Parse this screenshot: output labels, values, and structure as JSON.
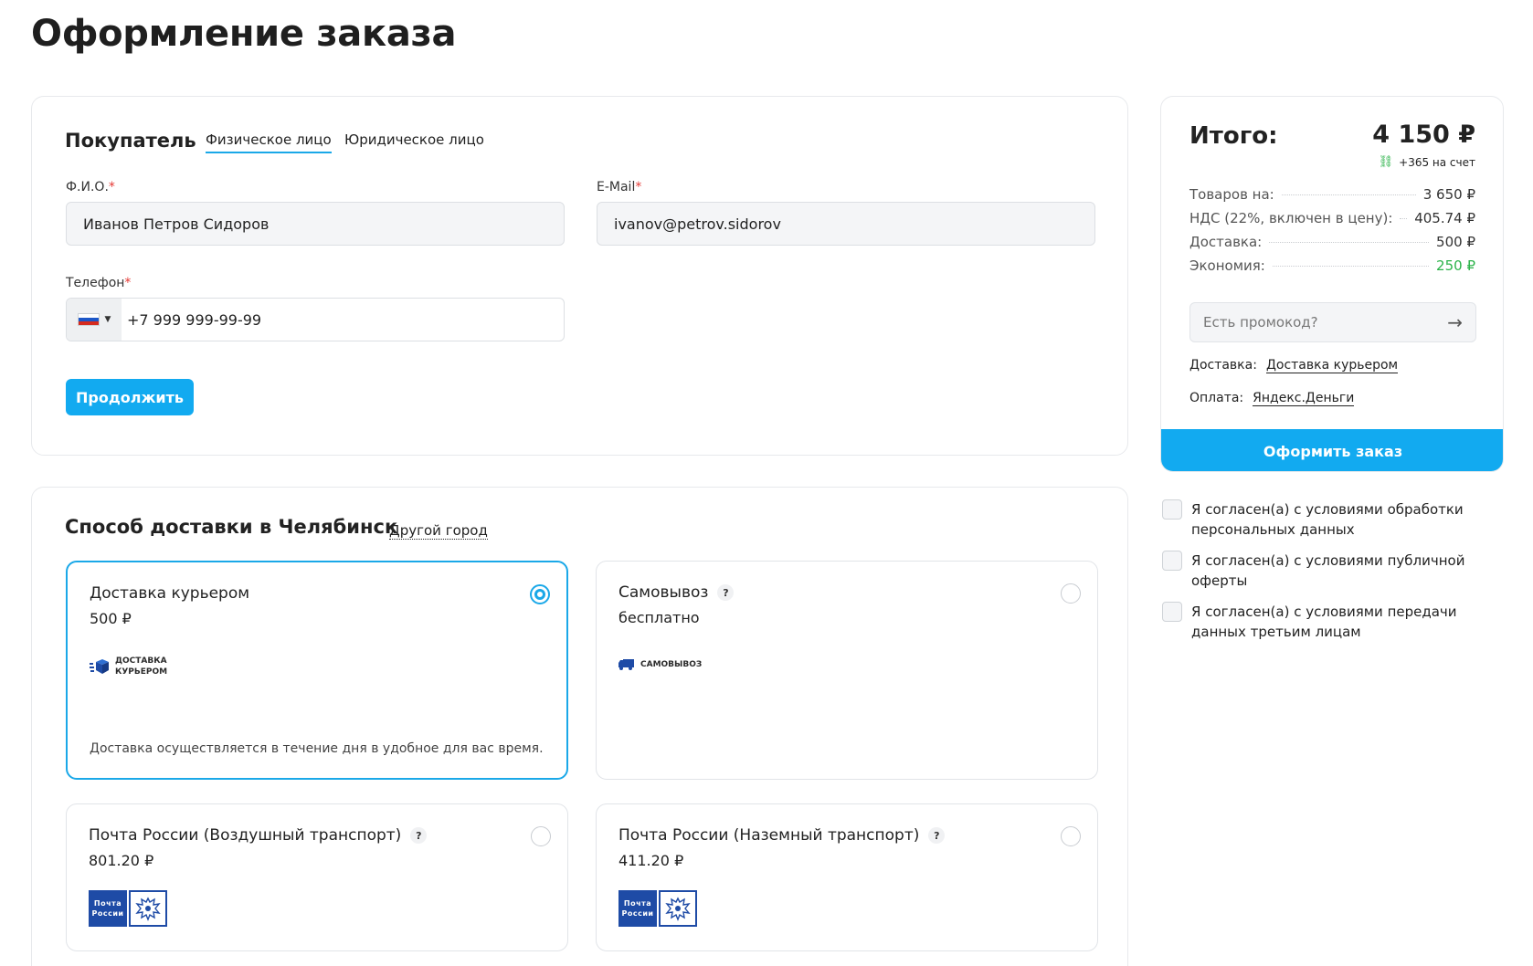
{
  "page": {
    "title": "Оформление заказа"
  },
  "buyer": {
    "title": "Покупатель",
    "tabs": [
      {
        "label": "Физическое лицо",
        "active": true
      },
      {
        "label": "Юридическое лицо",
        "active": false
      }
    ],
    "fio": {
      "label": "Ф.И.О.",
      "required_mark": "*",
      "value": "Иванов Петров Сидоров"
    },
    "email": {
      "label": "E-Mail",
      "required_mark": "*",
      "value": "ivanov@petrov.sidorov"
    },
    "phone": {
      "label": "Телефон",
      "required_mark": "*",
      "value": "+7 999 999-99-99",
      "country_icon": "russia-flag-icon"
    },
    "continue_label": "Продолжить"
  },
  "delivery": {
    "title": "Способ доставки в Челябинск",
    "other_city_label": "Другой город",
    "options": [
      {
        "title": "Доставка курьером",
        "price": "500 ₽",
        "logo_text_1": "Доставка",
        "logo_text_2": "курьером",
        "description": "Доставка осуществляется в течение дня в удобное для вас время.",
        "selected": true,
        "has_help": false
      },
      {
        "title": "Самовывоз",
        "price": "бесплатно",
        "logo_text_1": "Самовывоз",
        "selected": false,
        "has_help": true,
        "help": "?"
      },
      {
        "title": "Почта России (Воздушный транспорт)",
        "price": "801.20 ₽",
        "logo_text_1": "Почта",
        "logo_text_2": "России",
        "selected": false,
        "has_help": true,
        "help": "?"
      },
      {
        "title": "Почта России (Наземный транспорт)",
        "price": "411.20 ₽",
        "logo_text_1": "Почта",
        "logo_text_2": "России",
        "selected": false,
        "has_help": true,
        "help": "?"
      }
    ]
  },
  "summary": {
    "title": "Итого:",
    "total": "4 150 ₽",
    "bonus": "+365 на счет",
    "rows": [
      {
        "label": "Товаров на:",
        "value": "3 650 ₽"
      },
      {
        "label": "НДС (22%, включен в цену):",
        "value": "405.74 ₽"
      },
      {
        "label": "Доставка:",
        "value": "500 ₽"
      },
      {
        "label": "Экономия:",
        "value": "250 ₽"
      }
    ],
    "promo_placeholder": "Есть промокод?",
    "delivery_label": "Доставка:",
    "delivery_value": "Доставка курьером",
    "payment_label": "Оплата:",
    "payment_value": "Яндекс.Деньги",
    "order_button": "Оформить заказ"
  },
  "agreements": [
    "Я согласен(а) с условиями обработки персональных данных",
    "Я согласен(а) с условиями публичной оферты",
    "Я согласен(а) с условиями передачи данных третьим лицам"
  ],
  "colors": {
    "accent": "#12aaf0",
    "green": "#2cb34a",
    "required": "#e53935",
    "post_blue": "#1e4ba6"
  }
}
